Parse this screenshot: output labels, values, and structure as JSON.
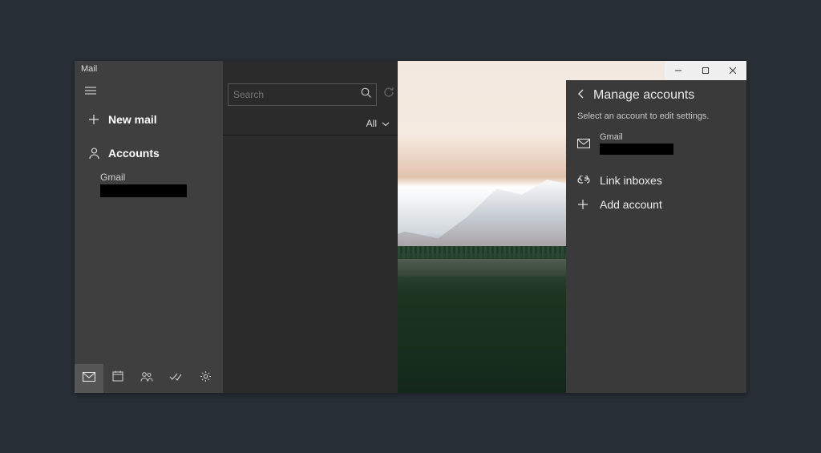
{
  "app": {
    "title": "Mail"
  },
  "sidebar": {
    "new_mail_label": "New mail",
    "accounts_label": "Accounts",
    "account": {
      "name": "Gmail"
    }
  },
  "list": {
    "search_placeholder": "Search",
    "filter_label": "All"
  },
  "manage": {
    "title": "Manage accounts",
    "description": "Select an account to edit settings.",
    "account": {
      "name": "Gmail"
    },
    "link_inboxes_label": "Link inboxes",
    "add_account_label": "Add account"
  }
}
